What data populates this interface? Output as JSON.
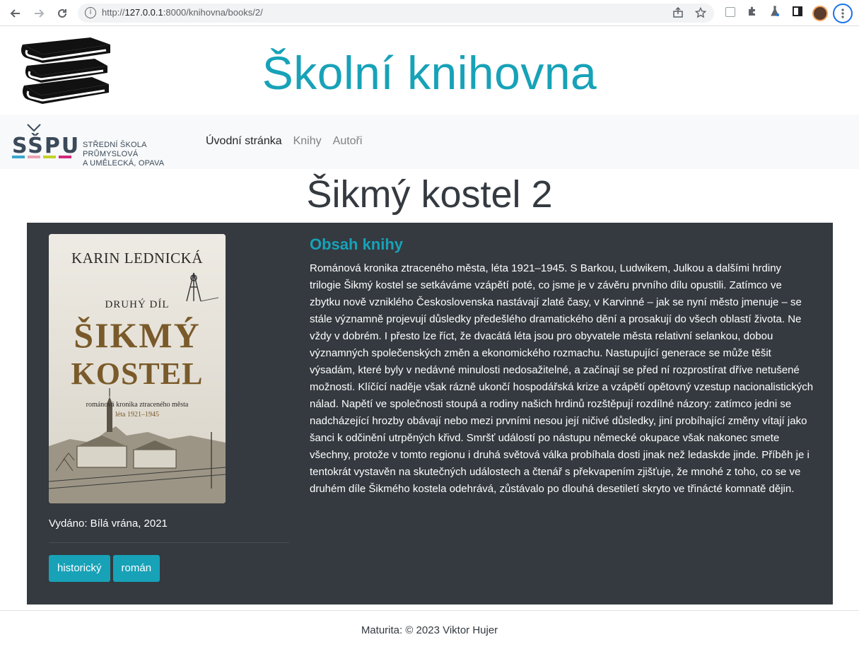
{
  "browser": {
    "url_prefix": "http://",
    "url_host": "127.0.0.1",
    "url_rest": ":8000/knihovna/books/2/",
    "info_glyph": "i",
    "back_icon": "arrow-left-icon",
    "forward_icon": "arrow-right-icon",
    "reload_icon": "reload-icon",
    "share_icon": "share-icon",
    "star_icon": "star-icon",
    "extension_icons": [
      "qr-icon",
      "puzzle-icon",
      "flask-icon",
      "sidebar-icon"
    ],
    "menu_icon": "kebab-menu-icon"
  },
  "header": {
    "title": "Školní knihovna",
    "logo_icon": "books-stack-icon"
  },
  "navbar": {
    "school_logo_letters": "SŠPU",
    "school_logo_line1": "STŘEDNÍ ŠKOLA PRŮMYSLOVÁ",
    "school_logo_line2": "A UMĚLECKÁ, OPAVA",
    "links": [
      {
        "label": "Úvodní stránka",
        "active": true
      },
      {
        "label": "Knihy",
        "active": false
      },
      {
        "label": "Autoři",
        "active": false
      }
    ],
    "colors": {
      "blue": "#3aa8cf",
      "pink": "#e9a3b3",
      "green": "#c5d12a",
      "magenta": "#d12a7c"
    }
  },
  "book": {
    "title": "Šikmý kostel 2",
    "cover": {
      "author": "KARIN LEDNICKÁ",
      "part": "DRUHÝ DÍL",
      "title_line1": "ŠIKMÝ",
      "title_line2": "KOSTEL",
      "subtitle": "románová kronika ztraceného města",
      "years": "léta 1921–1945"
    },
    "published": "Vydáno: Bílá vrána, 2021",
    "tags": [
      "historický",
      "román"
    ],
    "content_heading": "Obsah knihy",
    "content_text": "Románová kronika ztraceného města, léta 1921–1945. S Barkou, Ludwikem, Julkou a dalšími hrdiny trilogie Šikmý kostel se setkáváme vzápětí poté, co jsme je v závěru prvního dílu opustili. Zatímco ve zbytku nově vzniklého Československa nastávají zlaté časy, v Karvinné – jak se nyní město jmenuje – se stále významně projevují důsledky předešlého dramatického dění a prosakují do všech oblastí života. Ne vždy v dobrém. I přesto lze říct, že dvacátá léta jsou pro obyvatele města relativní selankou, dobou významných společenských změn a ekonomického rozmachu. Nastupující generace se může těšit výsadám, které byly v nedávné minulosti nedosažitelné, a začínají se před ní rozprostírat dříve netušené možnosti. Klíčící naděje však rázně ukončí hospodářská krize a vzápětí opětovný vzestup nacionalistických nálad. Napětí ve společnosti stoupá a rodiny našich hrdinů rozštěpují rozdílné názory: zatímco jedni se nadcházející hrozby obávají nebo mezi prvními nesou její ničivé důsledky, jiní probíhající změny vítají jako šanci k odčinění utrpěných křivd. Smršť událostí po nástupu německé okupace však nakonec smete všechny, protože v tomto regionu i druhá světová válka probíhala dosti jinak než ledaskde jinde. Příběh je i tentokrát vystavěn na skutečných událostech a čtenář s překvapením zjišťuje, že mnohé z toho, co se ve druhém díle Šikmého kostela odehrává, zůstávalo po dlouhá desetiletí skryto ve třinácté komnatě dějin."
  },
  "footer": {
    "text": "Maturita: © 2023 Viktor Hujer"
  },
  "theme": {
    "accent": "#17a2b8",
    "card_bg": "#343a40",
    "navbar_bg": "#f8f9fa"
  }
}
